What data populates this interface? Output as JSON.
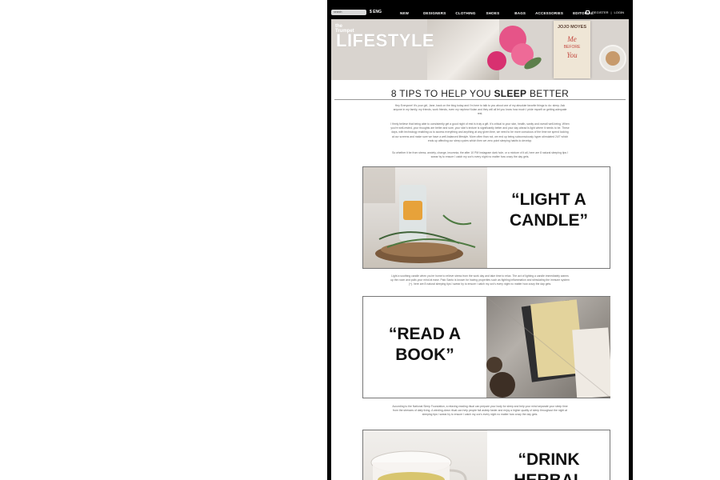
{
  "nav": {
    "search_placeholder": "search",
    "currency": "$ ENG",
    "menu": [
      "NEW",
      "DESIGNERS",
      "CLOTHING",
      "SHOES",
      "BAGS",
      "ACCESSORIES",
      "EDITORIAL"
    ],
    "register": "REGISTER",
    "separator": "|",
    "login": "LOGIN"
  },
  "hero": {
    "brand_line1": "the",
    "brand_line2": "Trumpet",
    "title": "LIFESTYLE",
    "book_author": "JOJO MOYES",
    "book_title_1": "Me",
    "book_title_2": "BEFORE",
    "book_title_3": "You"
  },
  "article": {
    "title_part1": "8 TIPS TO HELP YOU ",
    "title_bold": "SLEEP",
    "title_part2": " BETTER",
    "intro_1": "Hey Everyone! It's your girl, Jane, back on the blog today and I'm here to talk to you about one of my absolute favorite things to do: sleep. Ask anyone in my family, my friends, work friends, even my nephew Nolan and they will all let you know how much I pride myself on getting adequate rest.",
    "intro_2": "I firmly believe that being able to consistently get a good night of rest is truly a gift. It's critical to your skin, health, sanity and overall well-being. When you're well-rested, your thoughts are better and sure, your skin's texture is significantly better and your day ahead is light where it needs to be. These days, with technology enabling us to access everything and anything at any given time, we need to be more conscious of the time we spend looking at our screens and make sure we have a well-balanced lifestyle. More often than not, we end up being subconsciously hyper-stimulated 24/7 which ends up affecting our sleep cycles which then we zero point sleeping habits to develop.",
    "intro_3": "So whether it be from stress, anxiety, change, insomnia, the after 10 PM Instagram dark hole, or a mixture of it all, here are 8 natural sleeping tips I swear by to ensure I catch my zzz's every night no matter how crazy the day gets.",
    "tip1_heading": "“LIGHT A CANDLE”",
    "tip1_text": "Light a soothing candle when you're home to relieve stress from the work day and take time to relax. The act of lighting a candle immediately warms up the room and pulls your mind at ease. Palo Santo is known for having properties such as fighting inflammation and stimulating the immune system (+). here are 8 natural sleeping tips I swear by to ensure I catch my zzz's every night no matter how crazy the day gets.",
    "tip2_heading": "“READ A BOOK”",
    "tip2_text": "According to the National Sleep Foundation, a relaxing reading ritual can prepare your body for sleep and help your mind separate your sleep time from the stresses of daily living. A winding-down ritual can help people fall asleep faster and enjoy a higher quality of sleep throughout the night at sleeping tips I swear by to ensure I catch my zzz's every night no matter how crazy the day gets.",
    "tip3_heading": "“DRINK HERBAL"
  }
}
